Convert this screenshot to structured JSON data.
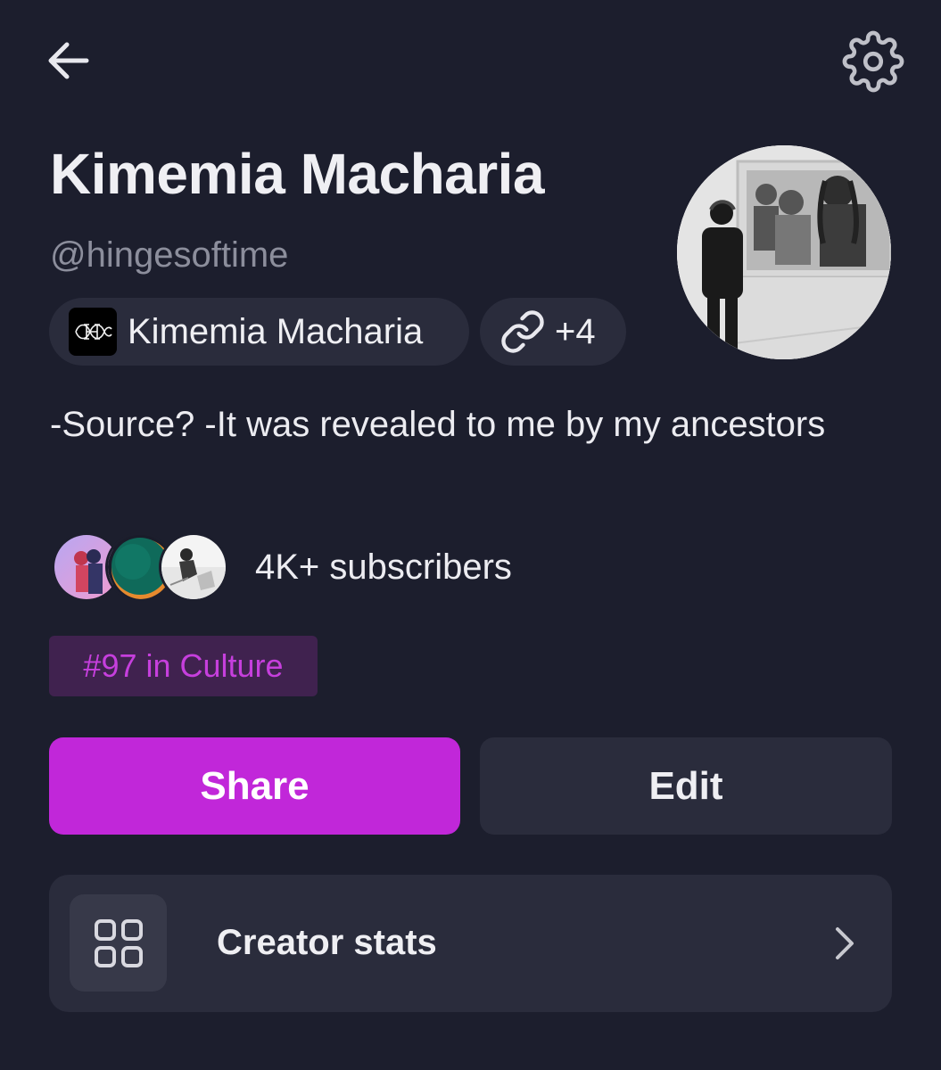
{
  "header": {
    "back_icon": "arrow-left-icon",
    "settings_icon": "gear-icon"
  },
  "profile": {
    "name": "Kimemia Macharia",
    "handle": "@hingesoftime",
    "publication_chip": {
      "label": "Kimemia Macharia",
      "logo_icon": "publication-logo-icon"
    },
    "links_chip": {
      "label": "+4",
      "icon": "link-icon"
    },
    "bio": "-Source? -It was revealed to me by my ancestors",
    "subscribers": {
      "count_label": "4K+ subscribers"
    },
    "rank_badge": "#97 in Culture"
  },
  "actions": {
    "share_label": "Share",
    "edit_label": "Edit"
  },
  "creator_stats": {
    "label": "Creator stats",
    "icon": "grid-icon",
    "chevron": "chevron-right-icon"
  },
  "colors": {
    "background": "#1c1e2d",
    "surface": "#2a2c3c",
    "accent": "#c127d9",
    "badge_bg": "#40224f",
    "badge_text": "#c63fdd",
    "muted_text": "#8c8e9c"
  }
}
